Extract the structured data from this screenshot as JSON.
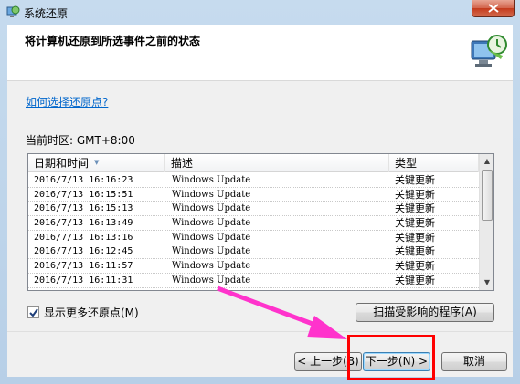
{
  "window": {
    "title": "系统还原",
    "header_title": "将计算机还原到所选事件之前的状态"
  },
  "help_link": "如何选择还原点?",
  "timezone": "当前时区: GMT+8:00",
  "table": {
    "columns": [
      "日期和时间",
      "描述",
      "类型"
    ],
    "rows": [
      {
        "date": "2016/7/13 16:16:23",
        "desc": "Windows Update",
        "type": "关键更新"
      },
      {
        "date": "2016/7/13 16:15:51",
        "desc": "Windows Update",
        "type": "关键更新"
      },
      {
        "date": "2016/7/13 16:15:13",
        "desc": "Windows Update",
        "type": "关键更新"
      },
      {
        "date": "2016/7/13 16:13:49",
        "desc": "Windows Update",
        "type": "关键更新"
      },
      {
        "date": "2016/7/13 16:13:16",
        "desc": "Windows Update",
        "type": "关键更新"
      },
      {
        "date": "2016/7/13 16:12:45",
        "desc": "Windows Update",
        "type": "关键更新"
      },
      {
        "date": "2016/7/13 16:11:57",
        "desc": "Windows Update",
        "type": "关键更新"
      },
      {
        "date": "2016/7/13 16:11:31",
        "desc": "Windows Update",
        "type": "关键更新"
      }
    ]
  },
  "show_more": {
    "label": "显示更多还原点(M)",
    "checked": true
  },
  "buttons": {
    "scan": "扫描受影响的程序(A)",
    "back": "< 上一步(B)",
    "next": "下一步(N) >",
    "cancel": "取消"
  },
  "colors": {
    "link": "#0066cc",
    "highlight": "#ff0000",
    "arrow": "#ff33cc"
  },
  "icons": {
    "app": "system-restore-icon",
    "header": "computer-restore-icon",
    "close": "close-icon",
    "checkbox": "checkmark-icon"
  }
}
